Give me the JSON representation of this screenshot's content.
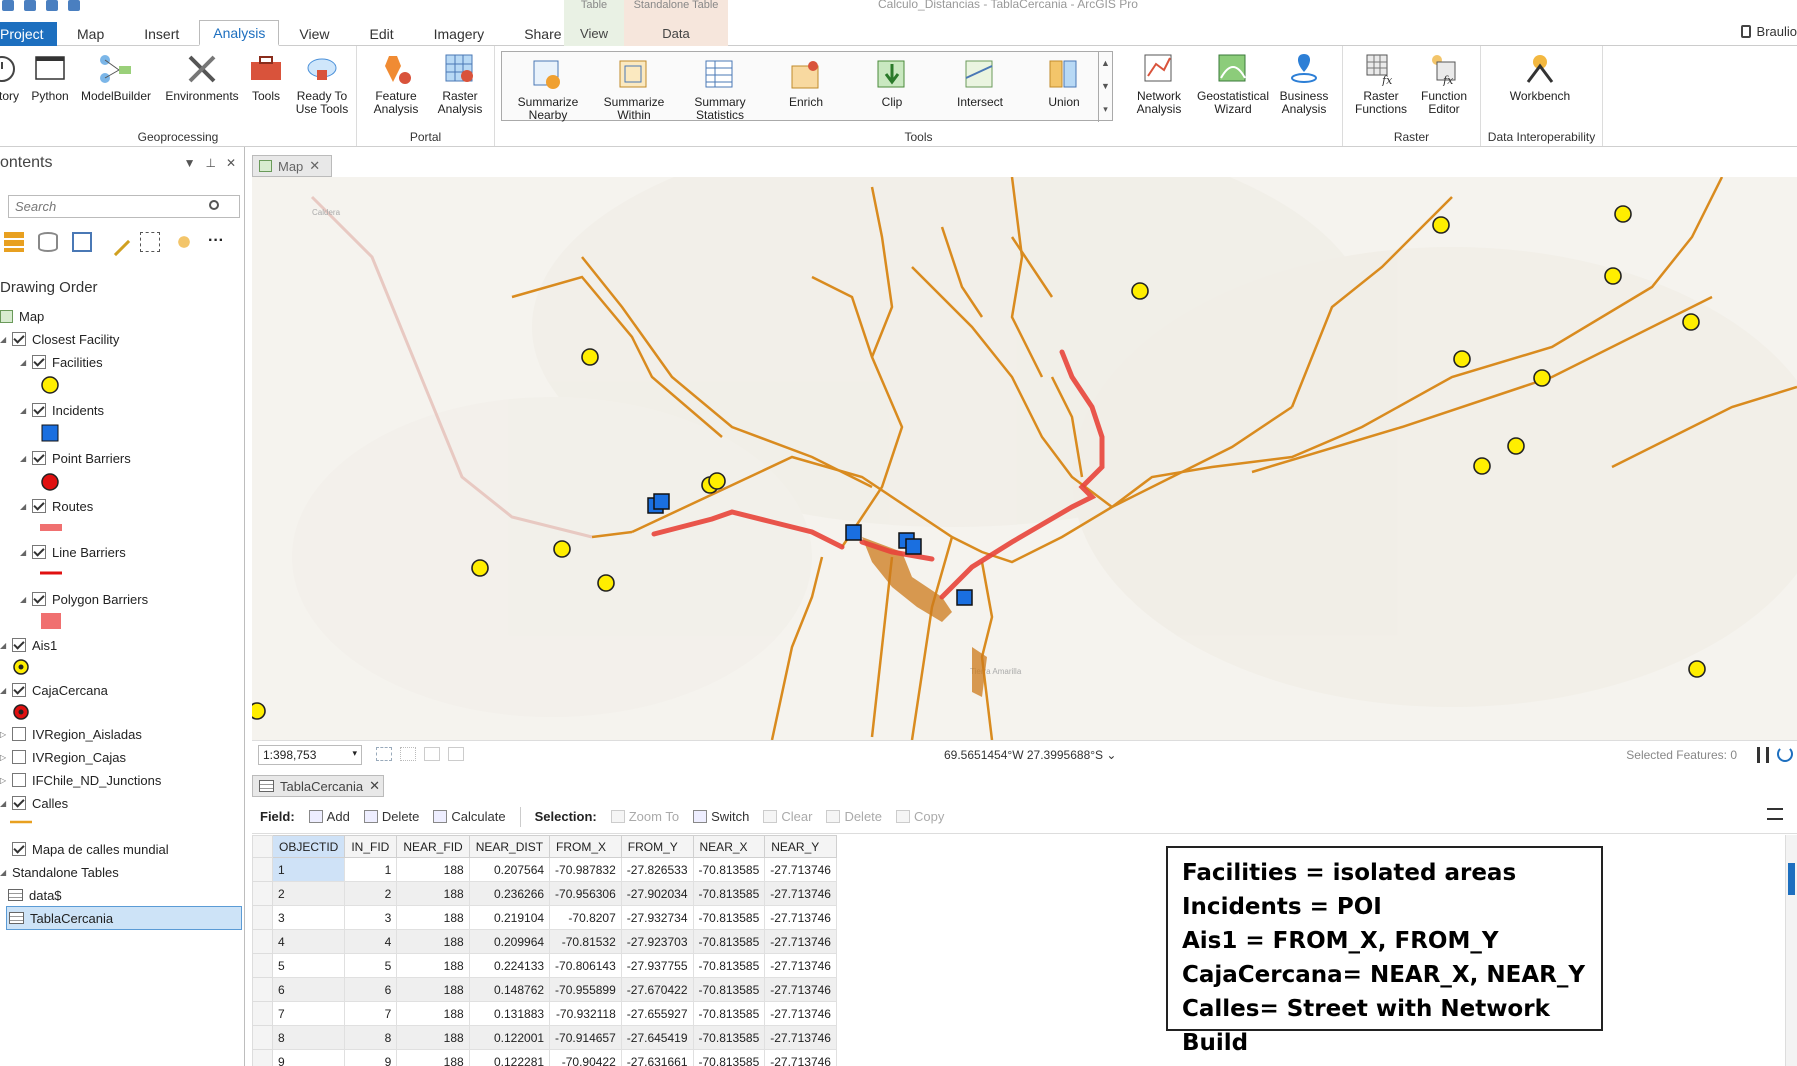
{
  "window": {
    "title": "Calculo_Distancias - TablaCercania - ArcGIS Pro",
    "user": "Braulio"
  },
  "ribbon_tabs": [
    "Project",
    "Map",
    "Insert",
    "Analysis",
    "View",
    "Edit",
    "Imagery",
    "Share"
  ],
  "context_tabs": [
    {
      "top": "Table",
      "label": "View"
    },
    {
      "top": "Standalone Table",
      "label": "Data"
    }
  ],
  "ribbon": {
    "geoprocessing": {
      "label": "Geoprocessing",
      "buttons": [
        "tory",
        "Python",
        "ModelBuilder",
        "Environments",
        "Tools",
        "Ready To\nUse Tools"
      ]
    },
    "portal": {
      "label": "Portal",
      "buttons": [
        "Feature\nAnalysis",
        "Raster\nAnalysis"
      ]
    },
    "tools": {
      "label": "Tools",
      "buttons": [
        "Summarize\nNearby",
        "Summarize\nWithin",
        "Summary\nStatistics",
        "Enrich",
        "Clip",
        "Intersect",
        "Union"
      ]
    },
    "tools_right": {
      "buttons": [
        "Network\nAnalysis",
        "Geostatistical\nWizard",
        "Business\nAnalysis"
      ]
    },
    "raster": {
      "label": "Raster",
      "buttons": [
        "Raster\nFunctions",
        "Function\nEditor"
      ]
    },
    "interop": {
      "label": "Data Interoperability",
      "buttons": [
        "Workbench"
      ]
    }
  },
  "contents": {
    "title": "ontents",
    "search_placeholder": "Search",
    "drawing_order": "Drawing Order",
    "items": [
      {
        "label": "Map"
      },
      {
        "label": "Closest Facility",
        "checked": true
      },
      {
        "label": "Facilities",
        "checked": true
      },
      {
        "label": "Incidents",
        "checked": true
      },
      {
        "label": "Point Barriers",
        "checked": true
      },
      {
        "label": "Routes",
        "checked": true
      },
      {
        "label": "Line Barriers",
        "checked": true
      },
      {
        "label": "Polygon Barriers",
        "checked": true
      },
      {
        "label": "Ais1",
        "checked": true
      },
      {
        "label": "CajaCercana",
        "checked": true
      },
      {
        "label": "IVRegion_Aisladas",
        "checked": false
      },
      {
        "label": "IVRegion_Cajas",
        "checked": false
      },
      {
        "label": "IFChile_ND_Junctions",
        "checked": false
      },
      {
        "label": "Calles",
        "checked": true
      },
      {
        "label": "Mapa de calles mundial",
        "checked": true
      },
      {
        "label": "Standalone Tables"
      },
      {
        "label": "data$"
      },
      {
        "label": "TablaCercania"
      }
    ]
  },
  "map": {
    "tab": "Map",
    "scale": "1:398,753",
    "coordinates": "69.5651454°W 27.3995688°S",
    "selected_features": "Selected Features: 0",
    "place_labels": [
      "Caldera",
      "Tierra Amarilla"
    ]
  },
  "table": {
    "tab": "TablaCercania",
    "toolbar": {
      "field": "Field:",
      "add": "Add",
      "delete": "Delete",
      "calculate": "Calculate",
      "selection": "Selection:",
      "zoom_to": "Zoom To",
      "switch": "Switch",
      "clear": "Clear",
      "delete2": "Delete",
      "copy": "Copy"
    },
    "columns": [
      "OBJECTID",
      "IN_FID",
      "NEAR_FID",
      "NEAR_DIST",
      "FROM_X",
      "FROM_Y",
      "NEAR_X",
      "NEAR_Y"
    ],
    "rows": [
      [
        "1",
        "1",
        "188",
        "0.207564",
        "-70.987832",
        "-27.826533",
        "-70.813585",
        "-27.713746"
      ],
      [
        "2",
        "2",
        "188",
        "0.236266",
        "-70.956306",
        "-27.902034",
        "-70.813585",
        "-27.713746"
      ],
      [
        "3",
        "3",
        "188",
        "0.219104",
        "-70.8207",
        "-27.932734",
        "-70.813585",
        "-27.713746"
      ],
      [
        "4",
        "4",
        "188",
        "0.209964",
        "-70.81532",
        "-27.923703",
        "-70.813585",
        "-27.713746"
      ],
      [
        "5",
        "5",
        "188",
        "0.224133",
        "-70.806143",
        "-27.937755",
        "-70.813585",
        "-27.713746"
      ],
      [
        "6",
        "6",
        "188",
        "0.148762",
        "-70.955899",
        "-27.670422",
        "-70.813585",
        "-27.713746"
      ],
      [
        "7",
        "7",
        "188",
        "0.131883",
        "-70.932118",
        "-27.655927",
        "-70.813585",
        "-27.713746"
      ],
      [
        "8",
        "8",
        "188",
        "0.122001",
        "-70.914657",
        "-27.645419",
        "-70.813585",
        "-27.713746"
      ],
      [
        "9",
        "9",
        "188",
        "0.122281",
        "-70.90422",
        "-27.631661",
        "-70.813585",
        "-27.713746"
      ]
    ]
  },
  "note": {
    "lines": [
      "Facilities = isolated areas",
      "Incidents = POI",
      "Ais1 = FROM_X, FROM_Y",
      "CajaCercana= NEAR_X, NEAR_Y",
      "Calles= Street with Network Build"
    ]
  },
  "colors": {
    "accent": "#1d6fbf",
    "facility": "#ffee00",
    "incident": "#1a6fe0",
    "route": "#e8443a",
    "street": "#d98b1f"
  }
}
